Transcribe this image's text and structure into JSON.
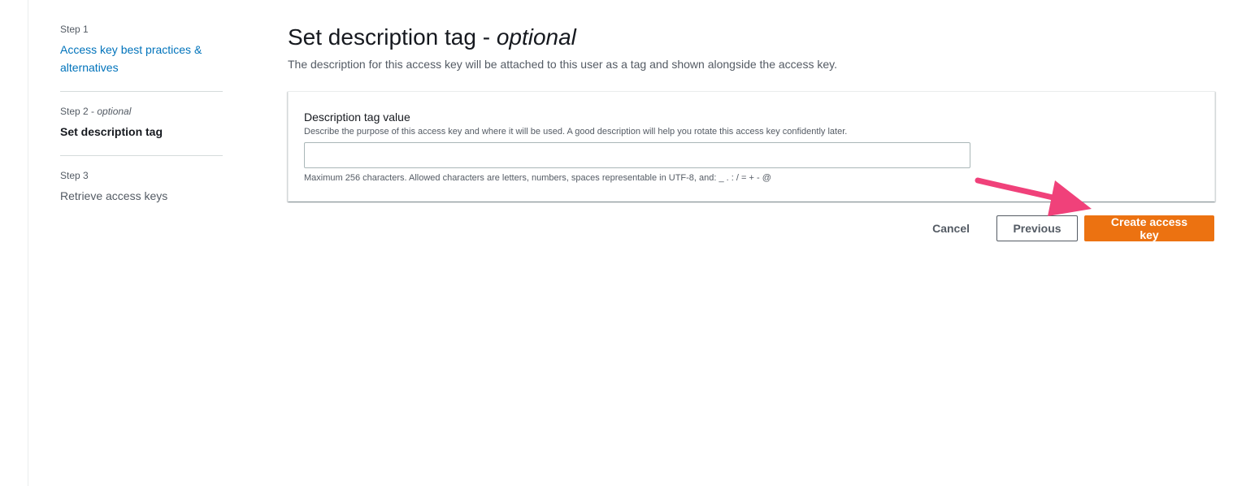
{
  "wizard": {
    "steps": [
      {
        "number": "Step 1",
        "optional": "",
        "title": "Access key best practices & alternatives",
        "state": "link"
      },
      {
        "number": "Step 2 - ",
        "optional": "optional",
        "title": "Set description tag",
        "state": "current"
      },
      {
        "number": "Step 3",
        "optional": "",
        "title": "Retrieve access keys",
        "state": "disabled"
      }
    ]
  },
  "main": {
    "title": "Set description tag - ",
    "title_optional": "optional",
    "description": "The description for this access key will be attached to this user as a tag and shown alongside the access key."
  },
  "form": {
    "label": "Description tag value",
    "description": "Describe the purpose of this access key and where it will be used. A good description will help you rotate this access key confidently later.",
    "value": "",
    "placeholder": "",
    "constraint": "Maximum 256 characters. Allowed characters are letters, numbers, spaces representable in UTF-8, and: _ . : / = + - @"
  },
  "actions": {
    "cancel_label": "Cancel",
    "previous_label": "Previous",
    "create_label": "Create access key"
  },
  "colors": {
    "primary_button": "#ec7211",
    "link": "#0073bb",
    "annotation_arrow": "#f0417a"
  },
  "annotation": {
    "icon": "pointer-arrow-icon"
  }
}
